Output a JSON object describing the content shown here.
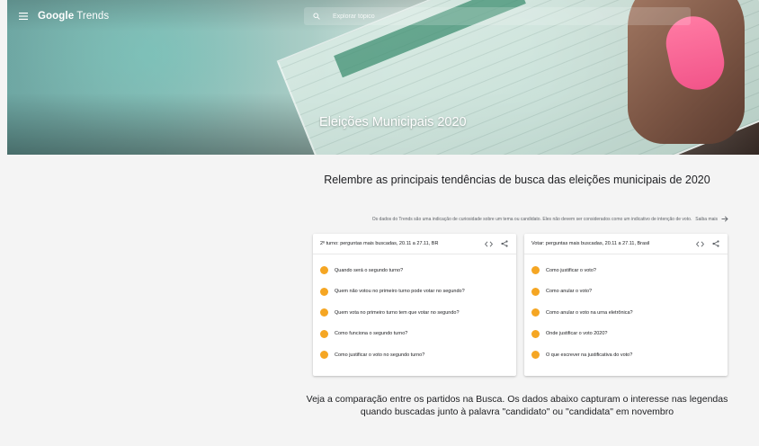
{
  "header": {
    "brand_google": "Google",
    "brand_trends": "Trends",
    "search_placeholder": "Explorar tópico"
  },
  "hero": {
    "title": "Eleições Municipais 2020"
  },
  "intro": {
    "headline": "Relembre as principais tendências de busca das eleições municipais de 2020",
    "disclaimer": "Os dados do Trends são uma indicação de curiosidade sobre um tema ou candidato. Eles não devem ser considerados como um indicativo de intenção de voto.",
    "learn_more": "Saiba mais"
  },
  "panels": [
    {
      "title": "2º turno: perguntas mais buscadas, 20.11 a 27.11, BR",
      "items": [
        "Quando será o segundo turno?",
        "Quem não votou no primeiro turno pode votar no segundo?",
        "Quem vota no primeiro turno tem que votar no segundo?",
        "Como funciona o segundo turno?",
        "Como justificar o voto no segundo turno?"
      ]
    },
    {
      "title": "Votar: perguntas mais buscadas, 20.11 a 27.11, Brasil",
      "items": [
        "Como justificar o voto?",
        "Como anular o voto?",
        "Como anular o voto na urna eletrônica?",
        "Onde justificar o voto 2020?",
        "O que escrever na justificativa do voto?"
      ]
    }
  ],
  "comparison": {
    "text": "Veja a comparação entre os partidos na Busca. Os dados abaixo capturam o interesse nas legendas quando buscadas junto à palavra \"candidato\" ou \"candidata\" em novembro"
  },
  "icons": {
    "menu": "menu-icon",
    "search": "search-icon",
    "embed": "embed-code-icon",
    "share": "share-icon",
    "arrow": "arrow-right-icon",
    "question": "question-bullet-icon"
  },
  "colors": {
    "accent_question": "#f5a623",
    "page_bg": "#f4f4f4"
  }
}
